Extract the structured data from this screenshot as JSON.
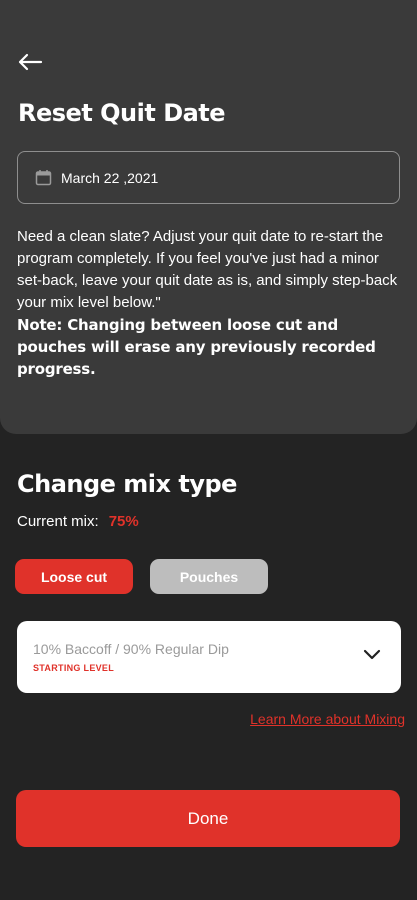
{
  "header": {
    "back_icon": "arrow-left-icon",
    "title": "Reset Quit Date"
  },
  "quit_date": {
    "icon": "calendar-icon",
    "value": "March 22 ,2021"
  },
  "description": "Need a clean slate? Adjust your quit date to re-start the program completely. If you feel you've just had a minor set-back, leave your quit date as is, and simply step-back your mix level below.\"",
  "note": "Note: Changing between loose cut and pouches will erase any previously recorded progress.",
  "mix": {
    "title": "Change mix type",
    "current_label": "Current mix:",
    "current_value": "75%",
    "types": [
      "Loose cut",
      "Pouches"
    ],
    "selected_type": "Loose cut",
    "select_value": "10% Baccoff / 90% Regular Dip",
    "select_level": "STARTING LEVEL",
    "select_icon": "chevron-down-icon",
    "learn_more": "Learn More about Mixing"
  },
  "done_label": "Done",
  "colors": {
    "accent": "#e0322a",
    "background": "#232323",
    "card": "#3a3a3a",
    "inactive": "#bdbdbd"
  }
}
